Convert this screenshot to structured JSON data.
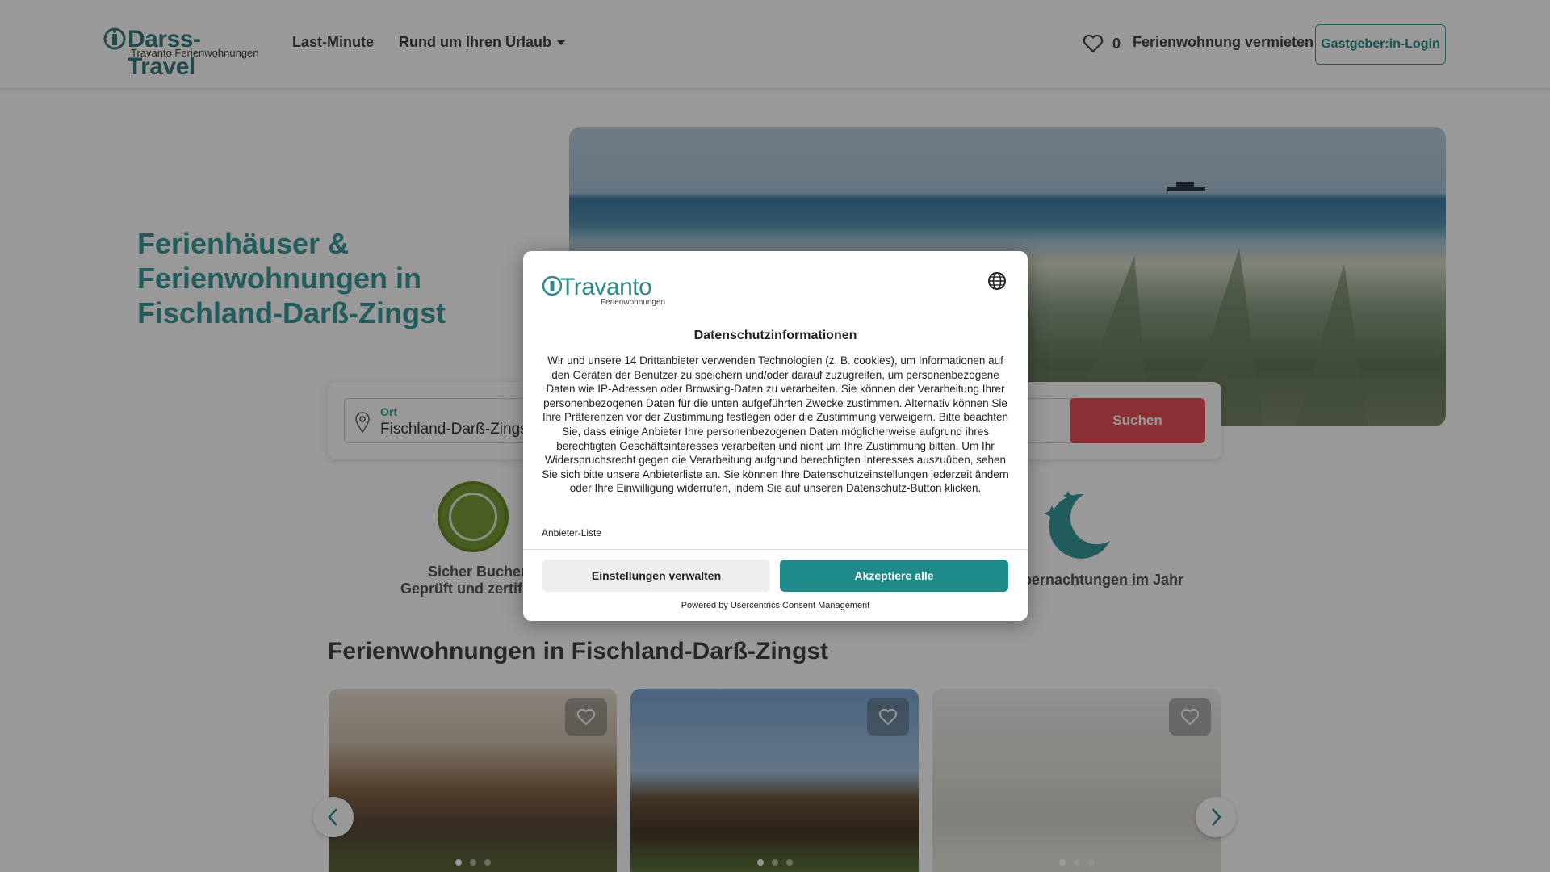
{
  "header": {
    "logo_main": "Darss-Travel",
    "logo_sub": "Travanto Ferienwohnungen",
    "nav_lastminute": "Last-Minute",
    "nav_rund": "Rund um Ihren Urlaub",
    "favorites_count": "0",
    "vermieten": "Ferienwohnung vermieten",
    "login": "Gastgeber:in-Login"
  },
  "hero": {
    "title": "Ferienhäuser & Ferienwohnungen in Fischland-Darß-Zingst"
  },
  "search": {
    "ort_label": "Ort",
    "ort_value": "Fischland-Darß-Zingst",
    "button": "Suchen"
  },
  "features": {
    "secure_title": "Sicher Buchen",
    "secure_sub": "Geprüft und zertifiziert",
    "nights": "Übernachtungen im Jahr"
  },
  "listing": {
    "title": "Ferienwohnungen in Fischland-Darß-Zingst"
  },
  "modal": {
    "logo_main": "Travanto",
    "logo_sub": "Ferienwohnungen",
    "title": "Datenschutzinformationen",
    "text": "Wir und unsere 14 Drittanbieter verwenden Technologien (z. B. cookies), um Informationen auf den Geräten der Benutzer zu speichern und/oder darauf zuzugreifen, um personenbezogene Daten wie IP-Adressen oder Browsing-Daten zu verarbeiten. Sie können der Verarbeitung Ihrer personenbezogenen Daten für die unten aufgeführten Zwecke zustimmen. Alternativ können Sie Ihre Präferenzen vor der Zustimmung festlegen oder die Zustimmung verweigern. Bitte beachten Sie, dass einige Anbieter Ihre personenbezogenen Daten möglicherweise aufgrund ihres berechtigten Geschäftsinteresses verarbeiten und nicht um Ihre Zustimmung bitten. Um Ihr Widerspruchsrecht gegen die Verarbeitung aufgrund berechtigten Interesses auszuüben, sehen Sie sich bitte unsere Anbieterliste an. Sie können Ihre Datenschutzeinstellungen jederzeit ändern oder Ihre Einwilligung widerrufen, indem Sie auf unseren Datenschutz-Button klicken.",
    "anbieter_link": "Anbieter-Liste",
    "btn_settings": "Einstellungen verwalten",
    "btn_accept": "Akzeptiere alle",
    "powered": "Powered by Usercentrics Consent Management"
  },
  "colors": {
    "brand_teal": "#2e8a8a",
    "search_red": "#e8535a"
  }
}
